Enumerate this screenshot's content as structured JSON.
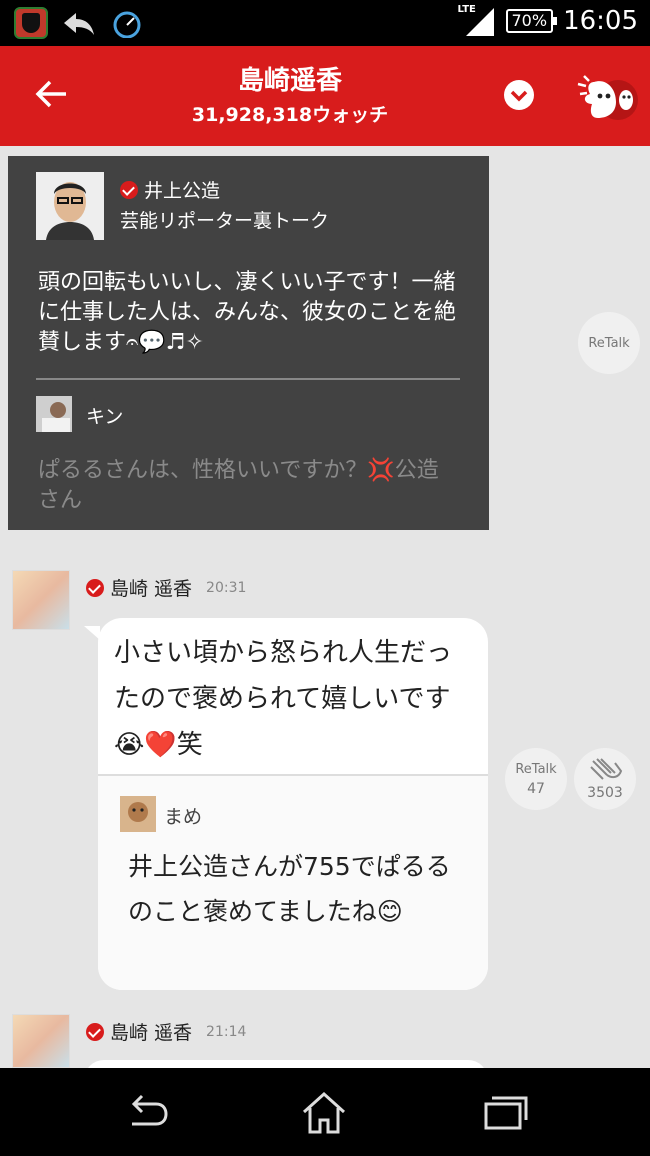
{
  "status_bar": {
    "network": "LTE",
    "battery": "70%",
    "time": "16:05"
  },
  "header": {
    "title": "島崎遥香",
    "subtitle": "31,928,318ウォッチ"
  },
  "quote_card": {
    "author": "井上公造",
    "author_subtitle": "芸能リポーター裏トーク",
    "body": "頭の回転もいいし、凄くいい子です！一緒に仕事した人は、みんな、彼女のことを絶賛します𝄐💬♬✧",
    "reply_name": "キン",
    "reply_body": "ぱるるさんは、性格いいですか？💢公造さん"
  },
  "retalk_label": "ReTalk",
  "post1": {
    "author": "島崎 遥香",
    "time": "20:31",
    "message": "小さい頃から怒られ人生だったので褒められて嬉しいです😭❤️笑",
    "retalk_count": "47",
    "clap_count": "3503",
    "quoted_name": "まめ",
    "quoted_body": "井上公造さんが755でぱるるのこと褒めてましたね😊"
  },
  "post2": {
    "author": "島崎 遥香",
    "time": "21:14"
  },
  "icons": {
    "accent": "#d81c1c"
  }
}
